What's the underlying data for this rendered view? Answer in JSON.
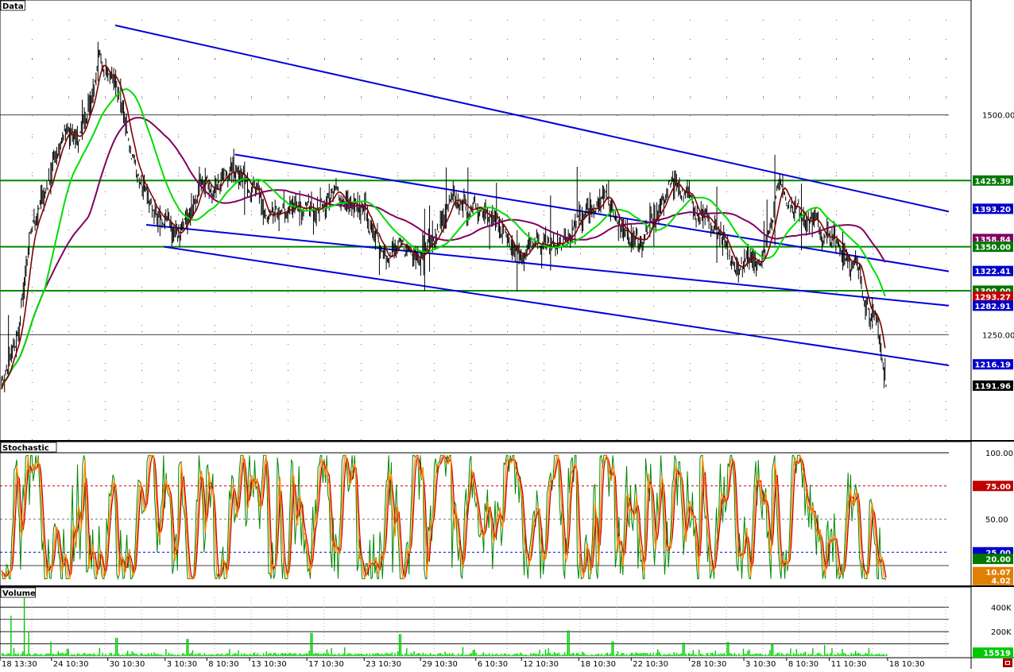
{
  "chart_data": [
    {
      "panel": "price",
      "type": "line",
      "title": "Data",
      "ylim": [
        1130,
        1620
      ],
      "y_ticks": [
        1250.0,
        1500.0
      ],
      "grid": true,
      "horizontal_levels": [
        1425.39,
        1350.0,
        1300.0
      ],
      "labels": [
        {
          "value": 1425.39,
          "text": "1425.39",
          "color": "#007800"
        },
        {
          "value": 1393.2,
          "text": "1393.20",
          "color": "#0000c8"
        },
        {
          "value": 1358.84,
          "text": "1358.84",
          "color": "#800060"
        },
        {
          "value": 1350.0,
          "text": "1350.00",
          "color": "#007800"
        },
        {
          "value": 1322.41,
          "text": "1322.41",
          "color": "#0000c8"
        },
        {
          "value": 1300.0,
          "text": "1300.00",
          "color": "#007800"
        },
        {
          "value": 1293.27,
          "text": "1293.27",
          "color": "#c00000"
        },
        {
          "value": 1282.91,
          "text": "1282.91",
          "color": "#0000c8"
        },
        {
          "value": 1216.19,
          "text": "1216.19",
          "color": "#0000c8"
        },
        {
          "value": 1191.96,
          "text": "1191.96",
          "color": "#000000"
        }
      ],
      "trend_channels": [
        {
          "name": "outer-upper",
          "from": [
            0.13,
            1602
          ],
          "to": [
            1.0,
            1390
          ]
        },
        {
          "name": "inner-upper",
          "from": [
            0.265,
            1455
          ],
          "to": [
            1.0,
            1322
          ]
        },
        {
          "name": "inner-lower",
          "from": [
            0.165,
            1375
          ],
          "to": [
            1.0,
            1283
          ]
        },
        {
          "name": "outer-lower",
          "from": [
            0.185,
            1350
          ],
          "to": [
            1.0,
            1215
          ]
        }
      ],
      "price_anchors": [
        [
          0.0,
          1195
        ],
        [
          0.02,
          1240
        ],
        [
          0.04,
          1370
        ],
        [
          0.06,
          1420
        ],
        [
          0.08,
          1480
        ],
        [
          0.1,
          1470
        ],
        [
          0.13,
          1560
        ],
        [
          0.15,
          1540
        ],
        [
          0.17,
          1460
        ],
        [
          0.19,
          1400
        ],
        [
          0.21,
          1380
        ],
        [
          0.23,
          1360
        ],
        [
          0.26,
          1415
        ],
        [
          0.29,
          1430
        ],
        [
          0.31,
          1440
        ],
        [
          0.33,
          1420
        ],
        [
          0.35,
          1375
        ],
        [
          0.38,
          1390
        ],
        [
          0.41,
          1395
        ],
        [
          0.44,
          1410
        ],
        [
          0.47,
          1390
        ],
        [
          0.5,
          1348
        ],
        [
          0.53,
          1345
        ],
        [
          0.56,
          1350
        ],
        [
          0.59,
          1395
        ],
        [
          0.62,
          1392
        ],
        [
          0.65,
          1380
        ],
        [
          0.68,
          1345
        ],
        [
          0.71,
          1350
        ],
        [
          0.74,
          1352
        ],
        [
          0.77,
          1398
        ],
        [
          0.8,
          1400
        ],
        [
          0.82,
          1360
        ],
        [
          0.84,
          1358
        ],
        [
          0.86,
          1385
        ],
        [
          0.88,
          1430
        ],
        [
          0.9,
          1405
        ],
        [
          0.92,
          1390
        ],
        [
          0.94,
          1360
        ],
        [
          0.96,
          1325
        ],
        [
          0.98,
          1332
        ],
        [
          1.0,
          1345
        ],
        [
          1.02,
          1425
        ],
        [
          1.04,
          1395
        ],
        [
          1.06,
          1385
        ],
        [
          1.08,
          1360
        ],
        [
          1.1,
          1350
        ],
        [
          1.12,
          1330
        ],
        [
          1.13,
          1300
        ],
        [
          1.14,
          1280
        ],
        [
          1.15,
          1250
        ],
        [
          1.16,
          1192
        ]
      ],
      "moving_averages": [
        {
          "name": "MA-short",
          "color": "#800000",
          "value": 1293.27
        },
        {
          "name": "MA-mid",
          "color": "#00dd00"
        },
        {
          "name": "MA-long",
          "color": "#800060",
          "value": 1358.84
        }
      ]
    },
    {
      "panel": "stochastic",
      "type": "line",
      "title": "Stochastic",
      "ylim": [
        0,
        100
      ],
      "y_ticks": [
        100.0,
        50.0
      ],
      "levels": [
        {
          "value": 75.0,
          "text": "75.00",
          "color": "#cc0000"
        },
        {
          "value": 25.0,
          "text": "25.00",
          "color": "#0000cc"
        }
      ],
      "labels": [
        {
          "value": 75.0,
          "text": "75.00",
          "color": "#c00000"
        },
        {
          "value": 25.0,
          "text": "25.00",
          "color": "#0000c8"
        },
        {
          "value": 20.0,
          "text": "20.00",
          "color": "#007800"
        },
        {
          "value": 10.07,
          "text": "10.07",
          "color": "#e08000"
        },
        {
          "value": 4.02,
          "text": "4.02",
          "color": "#e08000"
        }
      ],
      "series": [
        {
          "name": "%K",
          "color": "#008800"
        },
        {
          "name": "%D",
          "color": "#ff8800"
        },
        {
          "name": "slow",
          "color": "#cc0000"
        }
      ]
    },
    {
      "panel": "volume",
      "type": "bar",
      "title": "Volume",
      "ylim": [
        0,
        480000
      ],
      "y_ticks": [
        {
          "value": 400000,
          "text": "400K"
        },
        {
          "value": 200000,
          "text": "200K"
        }
      ],
      "grid_values": [
        400000,
        300000,
        200000,
        100000
      ],
      "last_value": {
        "value": 15519,
        "text": "15519",
        "color": "#00c800"
      },
      "spikes": [
        {
          "x": 0.01,
          "v": 330000
        },
        {
          "x": 0.025,
          "v": 480000
        },
        {
          "x": 0.03,
          "v": 200000
        },
        {
          "x": 0.055,
          "v": 120000
        },
        {
          "x": 0.13,
          "v": 150000
        },
        {
          "x": 0.21,
          "v": 140000
        },
        {
          "x": 0.35,
          "v": 190000
        },
        {
          "x": 0.45,
          "v": 180000
        },
        {
          "x": 0.64,
          "v": 210000
        },
        {
          "x": 0.69,
          "v": 120000
        },
        {
          "x": 0.77,
          "v": 110000
        },
        {
          "x": 0.82,
          "v": 115000
        },
        {
          "x": 0.87,
          "v": 100000
        },
        {
          "x": 0.93,
          "v": 90000
        }
      ]
    }
  ],
  "x_axis": {
    "ticks": [
      "18 13:30",
      "24 10:30",
      "30 10:30",
      "3 10:30",
      "8 10:30",
      "13 10:30",
      "17 10:30",
      "23 10:30",
      "29 10:30",
      "6 10:30",
      "12 10:30",
      "18 10:30",
      "22 10:30",
      "28 10:30",
      "3 10:30",
      "8 10:30",
      "11 10:30",
      "18 10:30"
    ],
    "positions": [
      0.0,
      0.053,
      0.111,
      0.17,
      0.213,
      0.257,
      0.316,
      0.375,
      0.433,
      0.49,
      0.537,
      0.596,
      0.65,
      0.71,
      0.766,
      0.81,
      0.854,
      0.914
    ]
  },
  "colors": {
    "grid": "#000000",
    "price": "#000000",
    "channel": "#0000dd",
    "level": "#008800",
    "label_text": "#ffffff"
  }
}
